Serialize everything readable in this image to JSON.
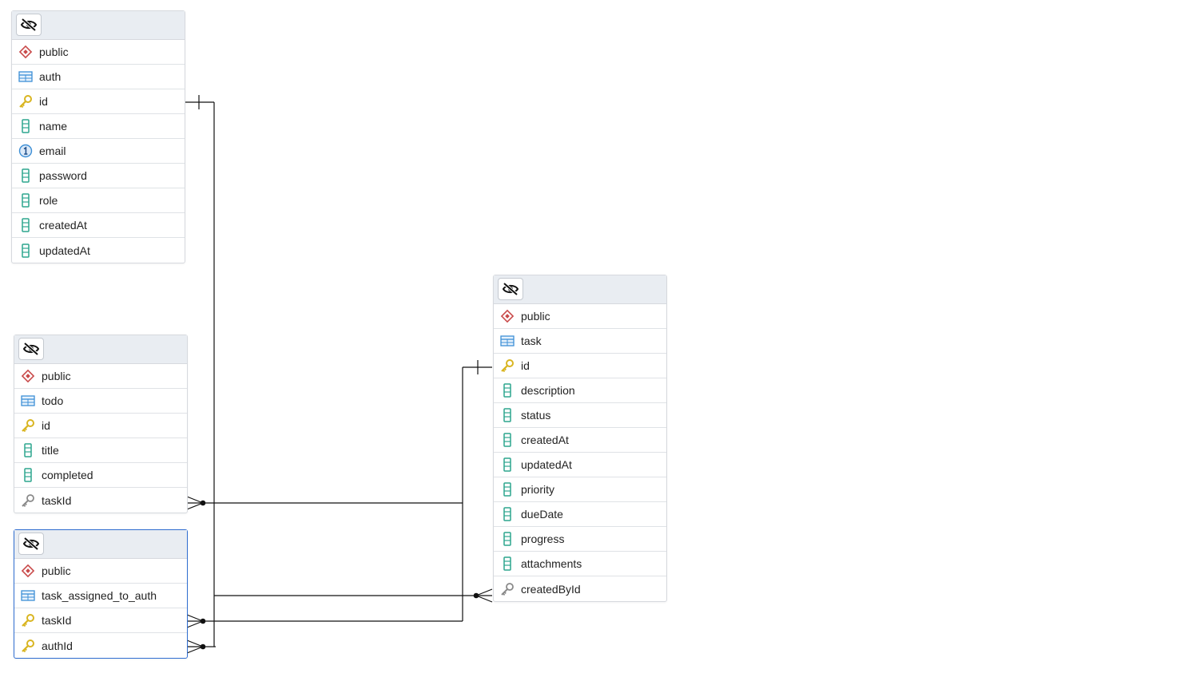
{
  "colors": {
    "header_bg": "#e9edf2",
    "schema_icon": "#c94a4a",
    "table_icon": "#3d8fd6",
    "pk_icon": "#d9b521",
    "column_icon": "#2da58e",
    "unique_icon": "#3d8fd6",
    "fk_icon": "#8a8a8a",
    "edge": "#111111",
    "selected_border": "#2f6dd0"
  },
  "tables": [
    {
      "id": "auth",
      "selected": false,
      "header_icon": "eye-slash-icon",
      "rows": [
        {
          "icon": "schema-icon",
          "label": "public"
        },
        {
          "icon": "table-icon",
          "label": "auth"
        },
        {
          "icon": "primary-key-icon",
          "label": "id"
        },
        {
          "icon": "column-icon",
          "label": "name"
        },
        {
          "icon": "unique-icon",
          "label": "email"
        },
        {
          "icon": "column-icon",
          "label": "password"
        },
        {
          "icon": "column-icon",
          "label": "role"
        },
        {
          "icon": "column-icon",
          "label": "createdAt"
        },
        {
          "icon": "column-icon",
          "label": "updatedAt"
        }
      ]
    },
    {
      "id": "todo",
      "selected": false,
      "header_icon": "eye-slash-icon",
      "rows": [
        {
          "icon": "schema-icon",
          "label": "public"
        },
        {
          "icon": "table-icon",
          "label": "todo"
        },
        {
          "icon": "primary-key-icon",
          "label": "id"
        },
        {
          "icon": "column-icon",
          "label": "title"
        },
        {
          "icon": "column-icon",
          "label": "completed"
        },
        {
          "icon": "foreign-key-icon",
          "label": "taskId"
        }
      ]
    },
    {
      "id": "task_assigned_to_auth",
      "selected": true,
      "header_icon": "eye-slash-icon",
      "rows": [
        {
          "icon": "schema-icon",
          "label": "public"
        },
        {
          "icon": "table-icon",
          "label": "task_assigned_to_auth"
        },
        {
          "icon": "primary-key-icon",
          "label": "taskId"
        },
        {
          "icon": "primary-key-icon",
          "label": "authId"
        }
      ]
    },
    {
      "id": "task",
      "selected": false,
      "header_icon": "eye-slash-icon",
      "rows": [
        {
          "icon": "schema-icon",
          "label": "public"
        },
        {
          "icon": "table-icon",
          "label": "task"
        },
        {
          "icon": "primary-key-icon",
          "label": "id"
        },
        {
          "icon": "column-icon",
          "label": "description"
        },
        {
          "icon": "column-icon",
          "label": "status"
        },
        {
          "icon": "column-icon",
          "label": "createdAt"
        },
        {
          "icon": "column-icon",
          "label": "updatedAt"
        },
        {
          "icon": "column-icon",
          "label": "priority"
        },
        {
          "icon": "column-icon",
          "label": "dueDate"
        },
        {
          "icon": "column-icon",
          "label": "progress"
        },
        {
          "icon": "column-icon",
          "label": "attachments"
        },
        {
          "icon": "foreign-key-icon",
          "label": "createdById"
        }
      ]
    }
  ],
  "relationships": [
    {
      "from_table": "todo",
      "from_column": "taskId",
      "to_table": "task",
      "to_column": "id",
      "cardinality": "many-to-one"
    },
    {
      "from_table": "task",
      "from_column": "createdById",
      "to_table": "auth",
      "to_column": "id",
      "cardinality": "many-to-one"
    },
    {
      "from_table": "task_assigned_to_auth",
      "from_column": "taskId",
      "to_table": "task",
      "to_column": "id",
      "cardinality": "many-to-one"
    },
    {
      "from_table": "task_assigned_to_auth",
      "from_column": "authId",
      "to_table": "auth",
      "to_column": "id",
      "cardinality": "many-to-one"
    }
  ]
}
